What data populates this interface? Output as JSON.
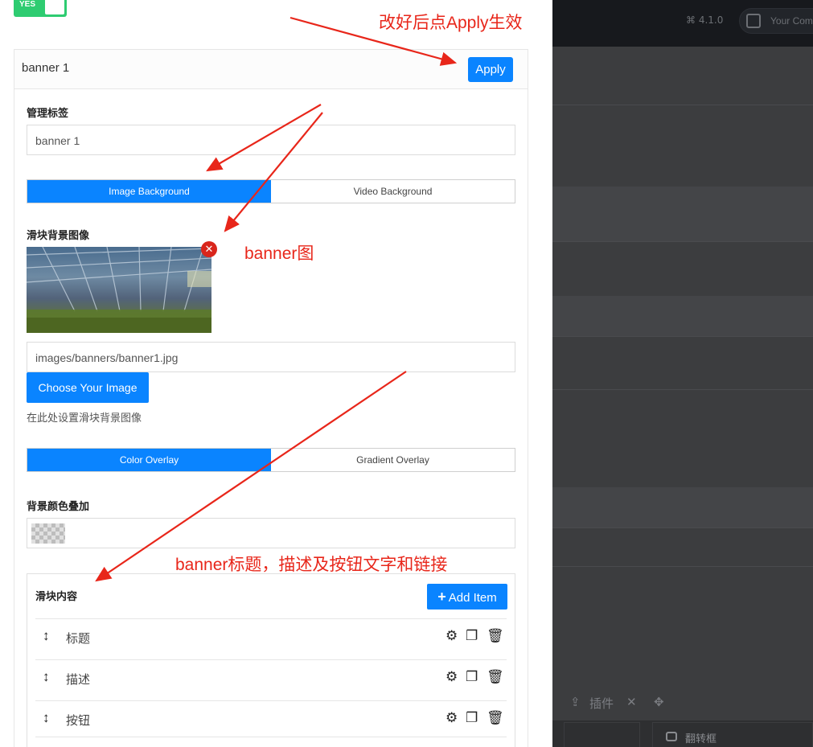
{
  "background": {
    "version": "4.1.0",
    "company_button": "Your Com",
    "toolbar_plugins": "插件",
    "bottom_tab": "翻转框"
  },
  "toggle": {
    "label": "YES",
    "state": "on"
  },
  "panel": {
    "title": "banner 1",
    "apply_label": "Apply",
    "admin_label_title": "管理标签",
    "admin_label_value": "banner 1",
    "background_tabs": {
      "items": [
        "Image Background",
        "Video Background"
      ],
      "active": "Image Background"
    },
    "slide_bg_image_title": "滑块背景图像",
    "image_path_value": "images/banners/banner1.jpg",
    "choose_image_label": "Choose Your Image",
    "image_help": "在此处设置滑块背景图像",
    "overlay_tabs": {
      "items": [
        "Color Overlay",
        "Gradient Overlay"
      ],
      "active": "Color Overlay"
    },
    "bg_color_overlay_title": "背景颜色叠加",
    "slide_content_title": "滑块内容",
    "add_item_label": "Add Item",
    "content_items": [
      {
        "name": "标题"
      },
      {
        "name": "描述"
      },
      {
        "name": "按钮"
      }
    ]
  },
  "annotations": {
    "apply_note": "改好后点Apply生效",
    "banner_note": "banner图",
    "content_note": "banner标题，描述及按钮文字和链接"
  },
  "colors": {
    "accent": "#0a84ff",
    "toggle_green": "#2ecc71",
    "annotation_red": "#e8261a",
    "remove_red": "#d9261c"
  },
  "icons": {
    "drag": "up-down-arrow-icon",
    "settings": "gear-icon",
    "duplicate": "copy-icon",
    "delete": "trash-icon",
    "remove_image": "close-circle-icon",
    "add": "plus-icon"
  }
}
